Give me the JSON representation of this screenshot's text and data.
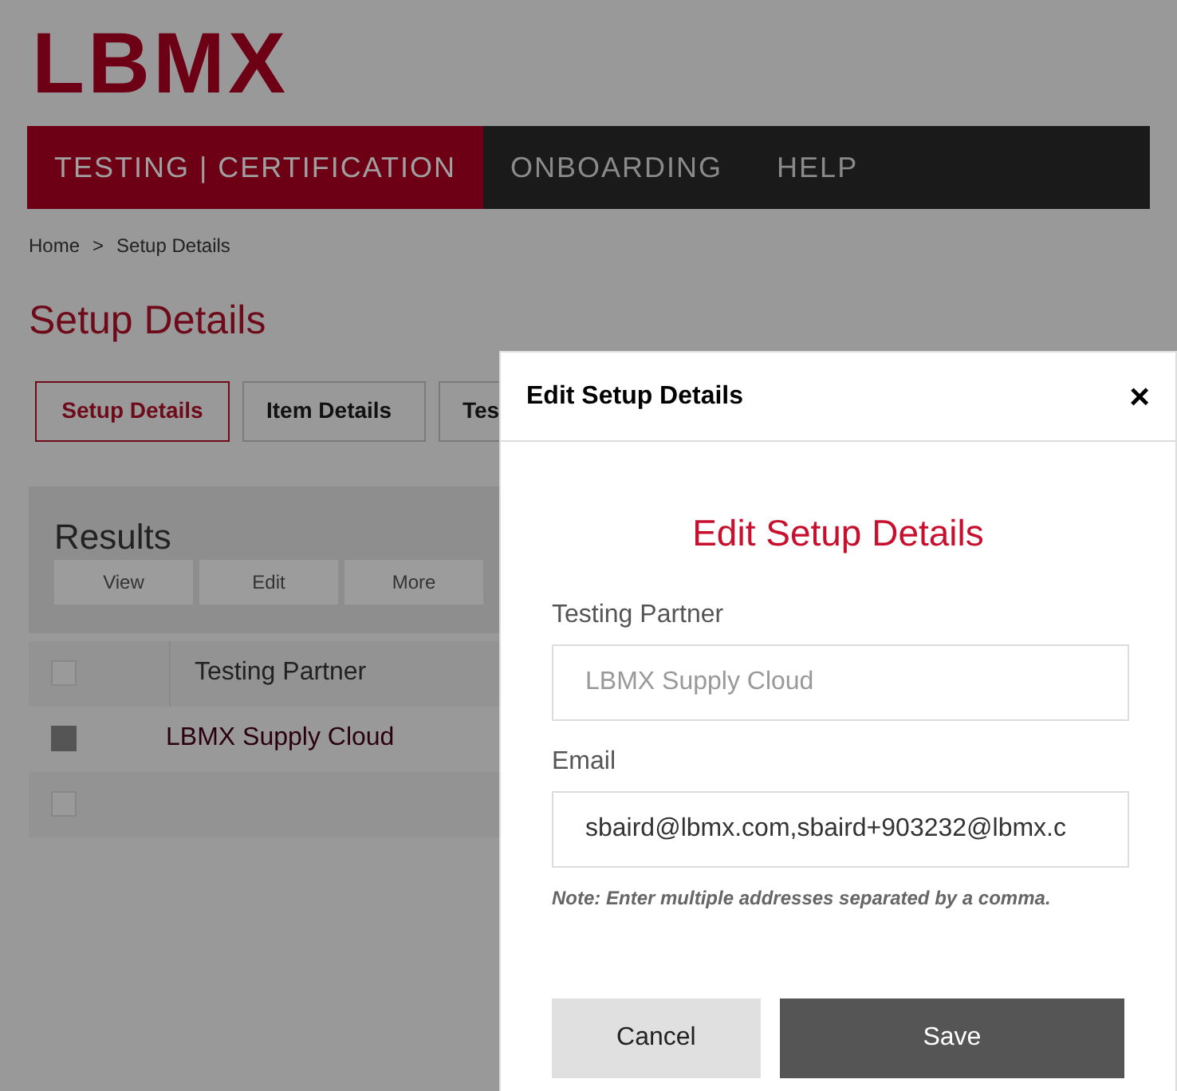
{
  "logo": {
    "text": "LBMX"
  },
  "nav": [
    {
      "label": "TESTING | CERTIFICATION",
      "selected": true
    },
    {
      "label": "ONBOARDING",
      "selected": false
    },
    {
      "label": "HELP",
      "selected": false
    }
  ],
  "breadcrumb": [
    {
      "label": "Home"
    },
    {
      "label": ">"
    },
    {
      "label": "Setup Details"
    }
  ],
  "page_title": "Setup Details",
  "tabs": [
    {
      "label": "Setup Details",
      "selected": true
    },
    {
      "label": "Item Details",
      "selected": false
    },
    {
      "label": "Tes",
      "selected": false
    }
  ],
  "results": {
    "title": "Results",
    "actions": [
      "View",
      "Edit",
      "More"
    ],
    "columns": [
      "Testing Partner"
    ],
    "header_checked": false,
    "rows": [
      {
        "checked": true,
        "cells": [
          "LBMX Supply Cloud"
        ]
      },
      {
        "checked": false,
        "cells": []
      }
    ]
  },
  "dialog": {
    "title": "Edit Setup Details",
    "close": "×",
    "heading": "Edit Setup Details",
    "fields": [
      {
        "label": "Testing Partner",
        "placeholder": "LBMX Supply Cloud"
      },
      {
        "label": "Email",
        "value": "sbaird@lbmx.com,sbaird+903232@lbmx.c"
      }
    ],
    "note": "Note: Enter multiple addresses separated by a comma.",
    "buttons": [
      {
        "label": "Cancel",
        "kind": "secondary"
      },
      {
        "label": "Save",
        "kind": "primary"
      }
    ]
  }
}
